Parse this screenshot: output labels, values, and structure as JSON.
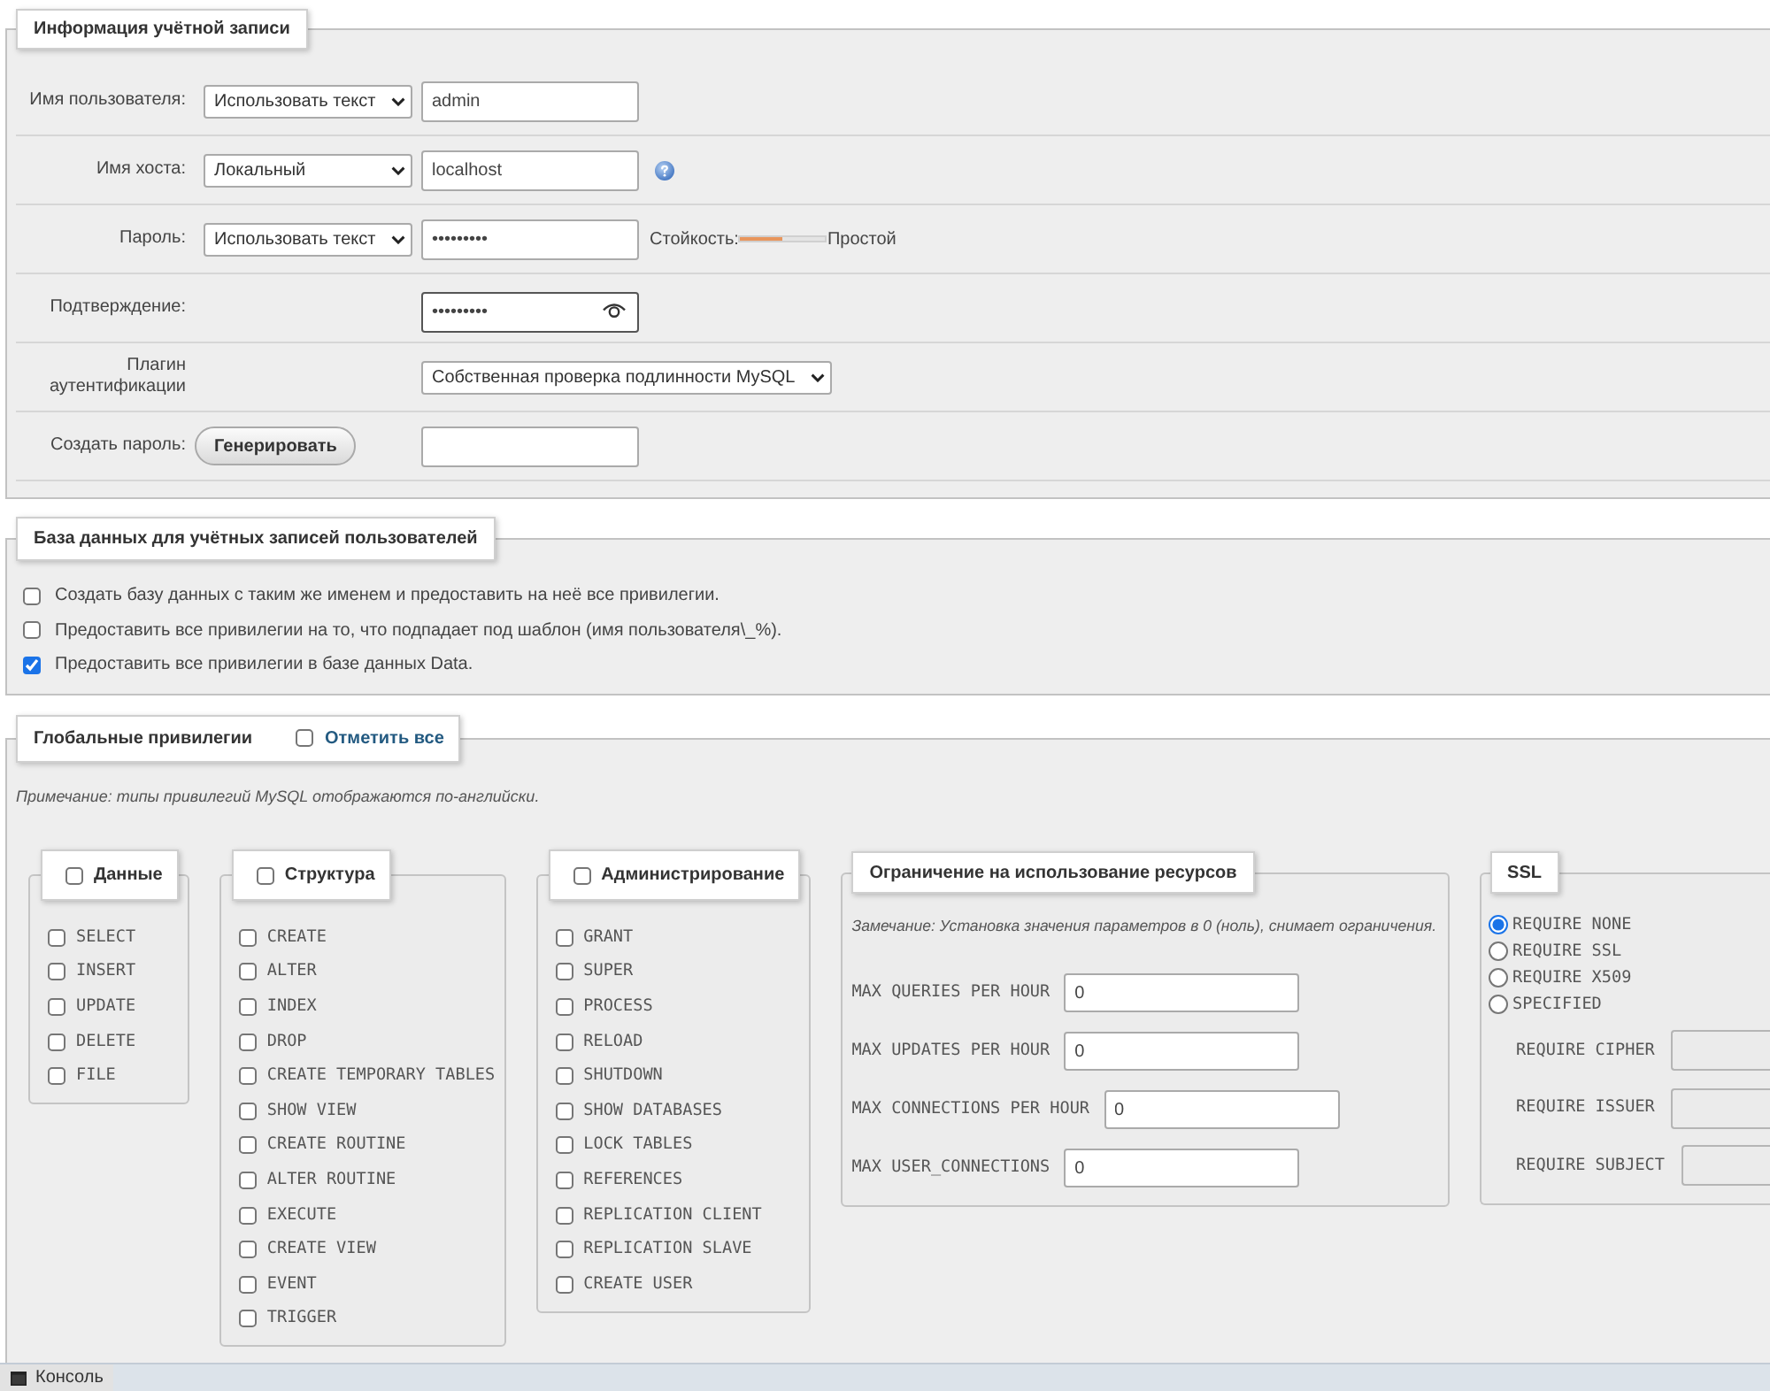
{
  "account": {
    "legend": "Информация учётной записи",
    "rows": [
      {
        "kind": "text",
        "label": "Имя пользователя:",
        "select": "Использовать текст",
        "value": "admin"
      },
      {
        "kind": "text",
        "label": "Имя хоста:",
        "select": "Локальный",
        "value": "localhost",
        "help": true
      },
      {
        "kind": "password",
        "label": "Пароль:",
        "select": "Использовать текст",
        "value": "•••••••••",
        "strength_label": "Стойкость:",
        "level": 0.48,
        "strength": "Простой"
      },
      {
        "kind": "confirm",
        "label": "Подтверждение:",
        "value": "•••••••••"
      },
      {
        "kind": "plugin",
        "label": "Плагин аутентификации",
        "select": "Собственная проверка подлинности MySQL"
      },
      {
        "kind": "generate",
        "label": "Создать пароль:",
        "button": "Генерировать"
      }
    ]
  },
  "user_database": {
    "legend": "База данных для учётных записей пользователей",
    "options": [
      {
        "label": "Создать базу данных с таким же именем и предоставить на неё все привилегии.",
        "checked": false
      },
      {
        "label": "Предоставить все привилегии на то, что подпадает под шаблон (имя пользователя\\_%).",
        "checked": false
      },
      {
        "label": "Предоставить все привилегии в базе данных Data.",
        "checked": true
      }
    ]
  },
  "global_privileges": {
    "legend": "Глобальные привилегии",
    "check_all": {
      "label": "Отметить все",
      "checked": false
    },
    "note": "Примечание: типы привилегий MySQL отображаются по-английски.",
    "groups": [
      {
        "title": "Данные",
        "checked": false,
        "items": [
          {
            "label": "SELECT",
            "checked": false
          },
          {
            "label": "INSERT",
            "checked": false
          },
          {
            "label": "UPDATE",
            "checked": false
          },
          {
            "label": "DELETE",
            "checked": false
          },
          {
            "label": "FILE",
            "checked": false
          }
        ]
      },
      {
        "title": "Структура",
        "checked": false,
        "items": [
          {
            "label": "CREATE",
            "checked": false
          },
          {
            "label": "ALTER",
            "checked": false
          },
          {
            "label": "INDEX",
            "checked": false
          },
          {
            "label": "DROP",
            "checked": false
          },
          {
            "label": "CREATE TEMPORARY TABLES",
            "checked": false
          },
          {
            "label": "SHOW VIEW",
            "checked": false
          },
          {
            "label": "CREATE ROUTINE",
            "checked": false
          },
          {
            "label": "ALTER ROUTINE",
            "checked": false
          },
          {
            "label": "EXECUTE",
            "checked": false
          },
          {
            "label": "CREATE VIEW",
            "checked": false
          },
          {
            "label": "EVENT",
            "checked": false
          },
          {
            "label": "TRIGGER",
            "checked": false
          }
        ]
      },
      {
        "title": "Администрирование",
        "checked": false,
        "items": [
          {
            "label": "GRANT",
            "checked": false
          },
          {
            "label": "SUPER",
            "checked": false
          },
          {
            "label": "PROCESS",
            "checked": false
          },
          {
            "label": "RELOAD",
            "checked": false
          },
          {
            "label": "SHUTDOWN",
            "checked": false
          },
          {
            "label": "SHOW DATABASES",
            "checked": false
          },
          {
            "label": "LOCK TABLES",
            "checked": false
          },
          {
            "label": "REFERENCES",
            "checked": false
          },
          {
            "label": "REPLICATION CLIENT",
            "checked": false
          },
          {
            "label": "REPLICATION SLAVE",
            "checked": false
          },
          {
            "label": "CREATE USER",
            "checked": false
          }
        ]
      }
    ],
    "resource_limits": {
      "legend": "Ограничение на использование ресурсов",
      "note": "Замечание: Установка значения параметров в 0 (ноль), снимает ограничения.",
      "fields": [
        {
          "label": "MAX QUERIES PER HOUR",
          "value": "0"
        },
        {
          "label": "MAX UPDATES PER HOUR",
          "value": "0"
        },
        {
          "label": "MAX CONNECTIONS PER HOUR",
          "value": "0"
        },
        {
          "label": "MAX USER_CONNECTIONS",
          "value": "0"
        }
      ]
    },
    "ssl": {
      "legend": "SSL",
      "options": [
        {
          "label": "REQUIRE NONE",
          "selected": true
        },
        {
          "label": "REQUIRE SSL",
          "selected": false
        },
        {
          "label": "REQUIRE X509",
          "selected": false
        },
        {
          "label": "SPECIFIED",
          "selected": false
        }
      ],
      "fields": [
        {
          "label": "REQUIRE CIPHER",
          "disabled": true
        },
        {
          "label": "REQUIRE ISSUER",
          "disabled": true
        },
        {
          "label": "REQUIRE SUBJECT",
          "disabled": true
        }
      ]
    }
  },
  "console": {
    "label": "Консоль"
  }
}
